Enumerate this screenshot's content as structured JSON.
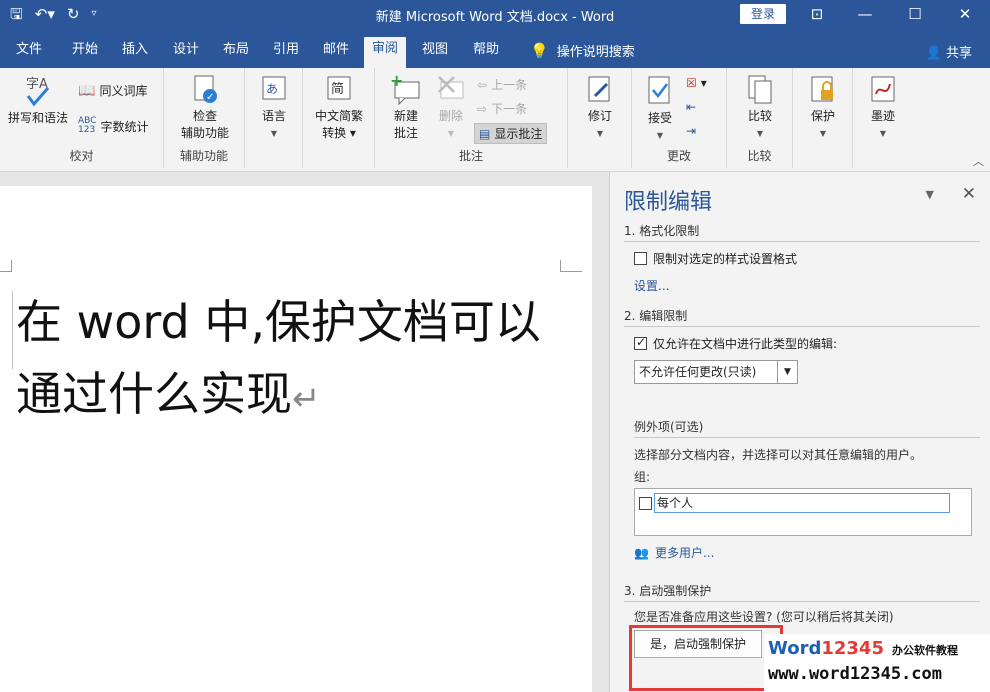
{
  "titlebar": {
    "title": "新建 Microsoft Word 文档.docx  -  Word",
    "login": "登录"
  },
  "tabs": [
    "文件",
    "开始",
    "插入",
    "设计",
    "布局",
    "引用",
    "邮件",
    "审阅",
    "视图",
    "帮助"
  ],
  "active_tab": "审阅",
  "tellme": "操作说明搜索",
  "share": "共享",
  "ribbon": {
    "proofing": {
      "spelling": "拼写和语法",
      "thesaurus": "同义词库",
      "wordcount": "字数统计",
      "label": "校对"
    },
    "accessibility": {
      "check1": "检查",
      "check2": "辅助功能",
      "label": "辅助功能"
    },
    "language": {
      "language": "语言"
    },
    "chinese": {
      "line1": "中文简繁",
      "line2": "转换"
    },
    "comments": {
      "new1": "新建",
      "new2": "批注",
      "delete": "删除",
      "prev": "上一条",
      "next": "下一条",
      "show": "显示批注",
      "label": "批注"
    },
    "tracking": {
      "track": "修订"
    },
    "changes": {
      "accept": "接受",
      "label": "更改"
    },
    "compare": {
      "compare": "比较",
      "label": "比较"
    },
    "protect": {
      "protect": "保护"
    },
    "ink": {
      "ink": "墨迹"
    }
  },
  "document": {
    "text": "在 word 中,保护文档可以通过什么实现"
  },
  "pane": {
    "title": "限制编辑",
    "s1": "1. 格式化限制",
    "s1_check": "限制对选定的样式设置格式",
    "s1_link": "设置...",
    "s2": "2. 编辑限制",
    "s2_check": "仅允许在文档中进行此类型的编辑:",
    "s2_select": "不允许任何更改(只读)",
    "exceptions": "例外项(可选)",
    "exceptions_desc": "选择部分文档内容，并选择可以对其任意编辑的用户。",
    "groups": "组:",
    "everyone": "每个人",
    "more_users": "更多用户...",
    "s3": "3. 启动强制保护",
    "s3_desc": "您是否准备应用这些设置? (您可以稍后将其关闭)",
    "start_button": "是，启动强制保护"
  },
  "watermark": {
    "brand_a": "Word",
    "brand_b": "12345",
    "tagline": "办公软件教程",
    "url": "www.word12345.com"
  }
}
